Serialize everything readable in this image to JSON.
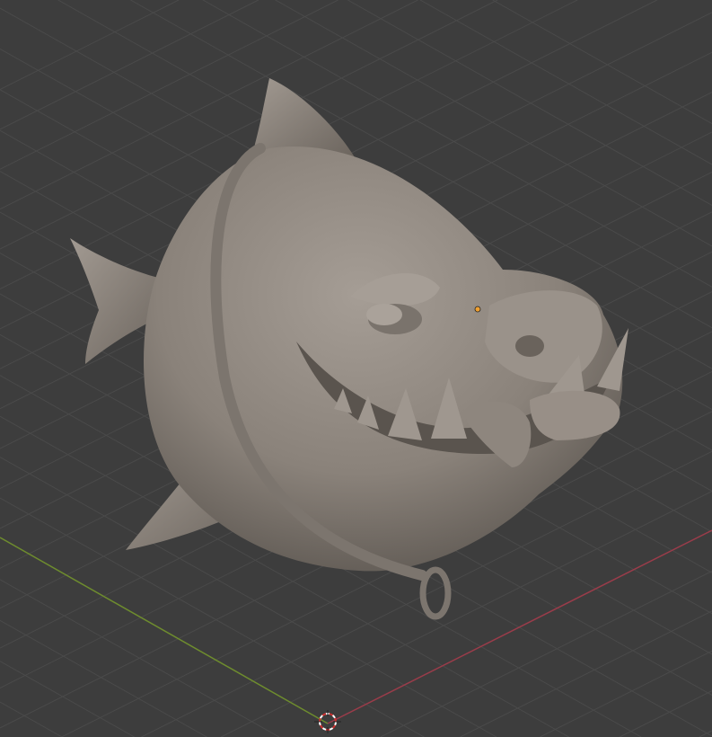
{
  "viewport": {
    "background_color": "#3d3d3d",
    "grid_color": "#4a4a4a",
    "x_axis_color": "#9a3c4a",
    "y_axis_color": "#6e8c2e",
    "model_color": "#8c847c",
    "origin_color": "#f0a030"
  },
  "icons": {
    "cursor": "3d-cursor-icon",
    "origin": "object-origin-icon"
  }
}
